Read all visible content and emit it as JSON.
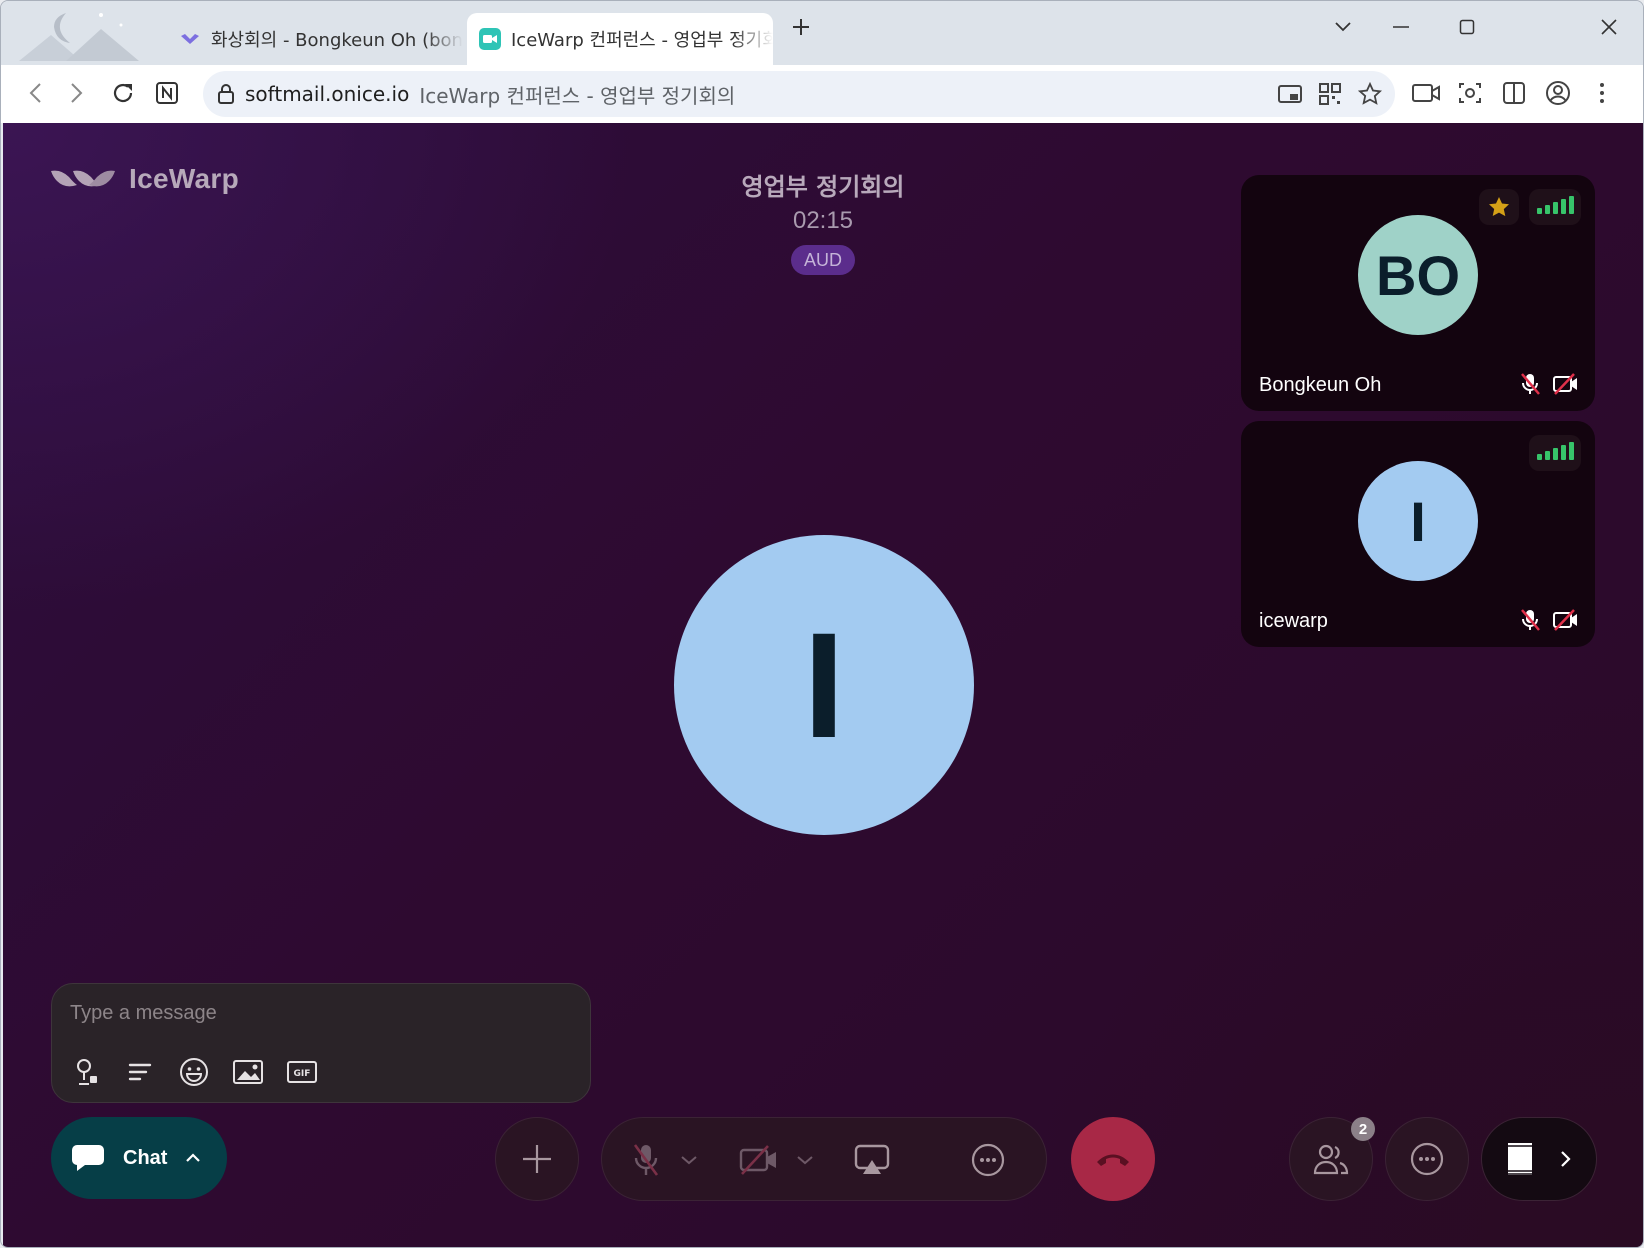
{
  "browser": {
    "tabs": [
      {
        "title": "화상회의 - Bongkeun Oh (bongk",
        "active": false
      },
      {
        "title": "IceWarp 컨퍼런스 - 영업부 정기회의",
        "active": true
      }
    ],
    "address": {
      "url": "softmail.onice.io",
      "page_title": "IceWarp 컨퍼런스 - 영업부 정기회의"
    }
  },
  "app": {
    "logo_text": "IceWarp",
    "meeting_title": "영업부 정기회의",
    "timer": "02:15",
    "mode_badge": "AUD",
    "main_speaker_initial": "I",
    "participants": [
      {
        "initials": "BO",
        "name": "Bongkeun Oh",
        "avatar_color": "#9fd2c8",
        "starred": true,
        "mic_muted": true,
        "video_off": true
      },
      {
        "initials": "I",
        "name": "icewarp",
        "avatar_color": "#a3cbf1",
        "starred": false,
        "mic_muted": true,
        "video_off": true
      }
    ],
    "composer": {
      "placeholder": "Type a message"
    },
    "chat_button_label": "Chat",
    "participants_count": "2",
    "colors": {
      "accent_badge": "#5b2d8c",
      "chat_button": "#063e47",
      "end_call": "#a82846",
      "signal": "#37c46a",
      "star": "#d4a017"
    }
  }
}
